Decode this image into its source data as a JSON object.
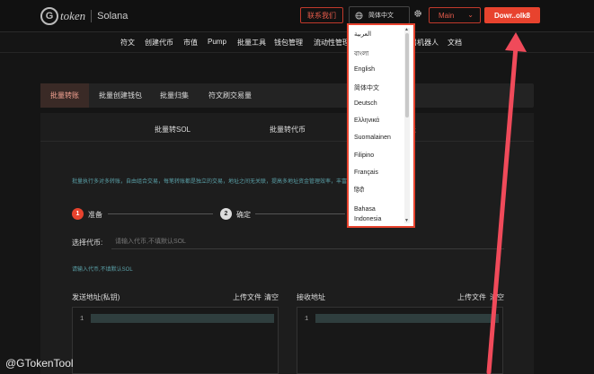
{
  "header": {
    "logo_letter": "G",
    "logo_text": "token",
    "network_label": "Solana",
    "contact_label": "联系我们",
    "language_label": "简体中文",
    "network_select": "Main",
    "download_label": "Dowr..olk8"
  },
  "nav": {
    "items": [
      "符文",
      "创建代币",
      "市值",
      "Pump",
      "批量工具",
      "钱包管理",
      "流动性管理",
      "交易机器人",
      "文档"
    ]
  },
  "tabs": {
    "items": [
      "批量转账",
      "批量创建钱包",
      "批量归集",
      "符文刷交易量"
    ],
    "active_index": 0
  },
  "subtabs": {
    "items": [
      "批量转SOL",
      "批量转代币",
      "账"
    ]
  },
  "description": "批量执行多对多转账，自由组合交易，每笔转账都是独立的交易，地址之间无关联，提高多地址资金管理效率，丰富您的资产管理策略组合。",
  "steps": {
    "step1_number": "1",
    "step1_label": "准备",
    "step2_number": "2",
    "step2_label": "确定"
  },
  "token": {
    "label": "选择代币:",
    "placeholder": "请输入代币,不填默认SOL",
    "hint": "请输入代币,不填默认SOL"
  },
  "send": {
    "label": "发送地址(私钥)",
    "upload": "上传文件",
    "clear": "清空",
    "line_number": "1"
  },
  "receive": {
    "label": "接收地址",
    "upload": "上传文件",
    "clear": "清空",
    "line_number": "1"
  },
  "language_dropdown": {
    "options": [
      "العربية",
      "বাংলা",
      "English",
      "简体中文",
      "Deutsch",
      "Ελληνικά",
      "Suomalainen",
      "Filipino",
      "Français",
      "हिंदी",
      "Bahasa Indonesia"
    ]
  },
  "watermark": "@GTokenTool",
  "colors": {
    "accent": "#e8432e",
    "background": "#151515",
    "hint_text": "#5aa0a8"
  }
}
